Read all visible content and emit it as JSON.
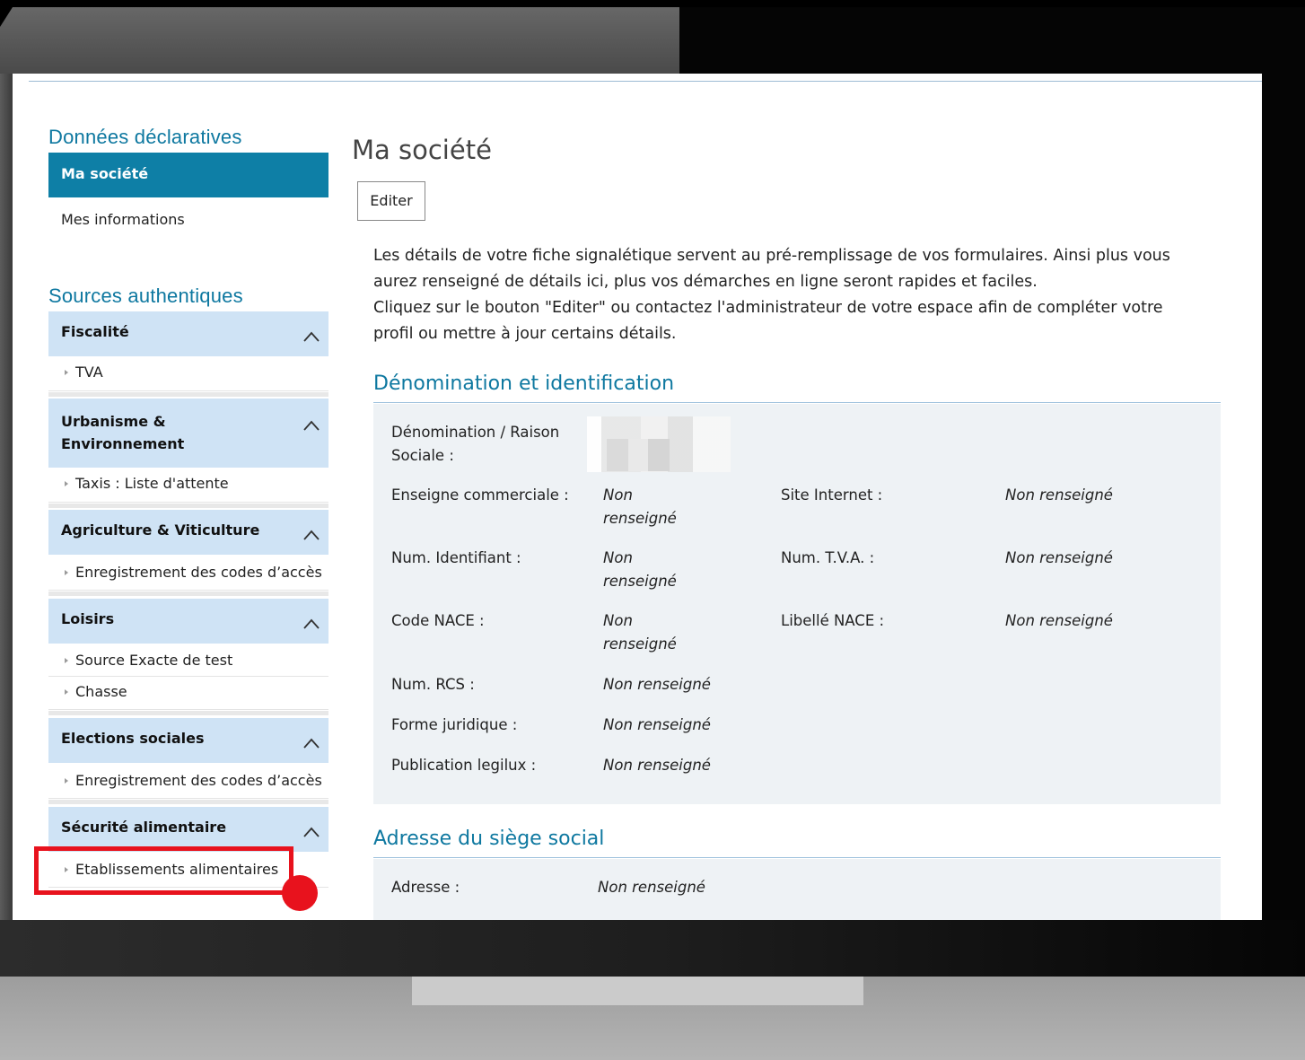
{
  "sidebar": {
    "declaratives_heading": "Données déclaratives",
    "active_item": "Ma société",
    "info_item": "Mes informations",
    "sources_heading": "Sources authentiques",
    "categories": [
      {
        "label": "Fiscalité",
        "items": [
          "TVA"
        ]
      },
      {
        "label": "Urbanisme & Environnement",
        "items": [
          "Taxis : Liste d'attente"
        ]
      },
      {
        "label": "Agriculture & Viticulture",
        "items": [
          "Enregistrement des codes d’accès"
        ]
      },
      {
        "label": "Loisirs",
        "items": [
          "Source Exacte de test",
          "Chasse"
        ]
      },
      {
        "label": "Elections sociales",
        "items": [
          "Enregistrement des codes d’accès"
        ]
      },
      {
        "label": "Sécurité alimentaire",
        "items": [
          "Etablissements alimentaires"
        ]
      }
    ]
  },
  "main": {
    "title": "Ma société",
    "edit_button": "Editer",
    "intro_line1": "Les détails de votre fiche signalétique servent au pré-remplissage de vos formulaires. Ainsi plus vous",
    "intro_line2": "aurez renseigné de détails ici, plus vos démarches en ligne seront rapides et faciles.",
    "intro_line3": "Cliquez sur le bouton \"Editer\" ou contactez l'administrateur de votre espace afin de compléter votre",
    "intro_line4": "profil ou mettre à jour certains détails.",
    "section_identification": {
      "title": "Dénomination et identification",
      "fields": {
        "denomination_label_1": "Dénomination / Raison",
        "denomination_label_2": "Sociale :",
        "enseigne_label": "Enseigne commerciale :",
        "enseigne_value_1": "Non",
        "enseigne_value_2": "renseigné",
        "site_label": "Site Internet :",
        "site_value": "Non renseigné",
        "num_id_label": "Num. Identifiant :",
        "num_id_value_1": "Non",
        "num_id_value_2": "renseigné",
        "tva_label": "Num. T.V.A. :",
        "tva_value": "Non renseigné",
        "nace_label": "Code NACE :",
        "nace_value_1": "Non",
        "nace_value_2": "renseigné",
        "libelle_label": "Libellé NACE :",
        "libelle_value": "Non renseigné",
        "rcs_label": "Num. RCS :",
        "rcs_value": "Non renseigné",
        "forme_label": "Forme juridique :",
        "forme_value": "Non renseigné",
        "legilux_label": "Publication legilux :",
        "legilux_value": "Non renseigné"
      }
    },
    "section_address": {
      "title": "Adresse du siège social",
      "adresse_label": "Adresse :",
      "adresse_value": "Non renseigné"
    }
  },
  "colors": {
    "accent": "#0e7fa6",
    "category_bg": "#cfe3f5",
    "highlight": "#e8121d"
  }
}
